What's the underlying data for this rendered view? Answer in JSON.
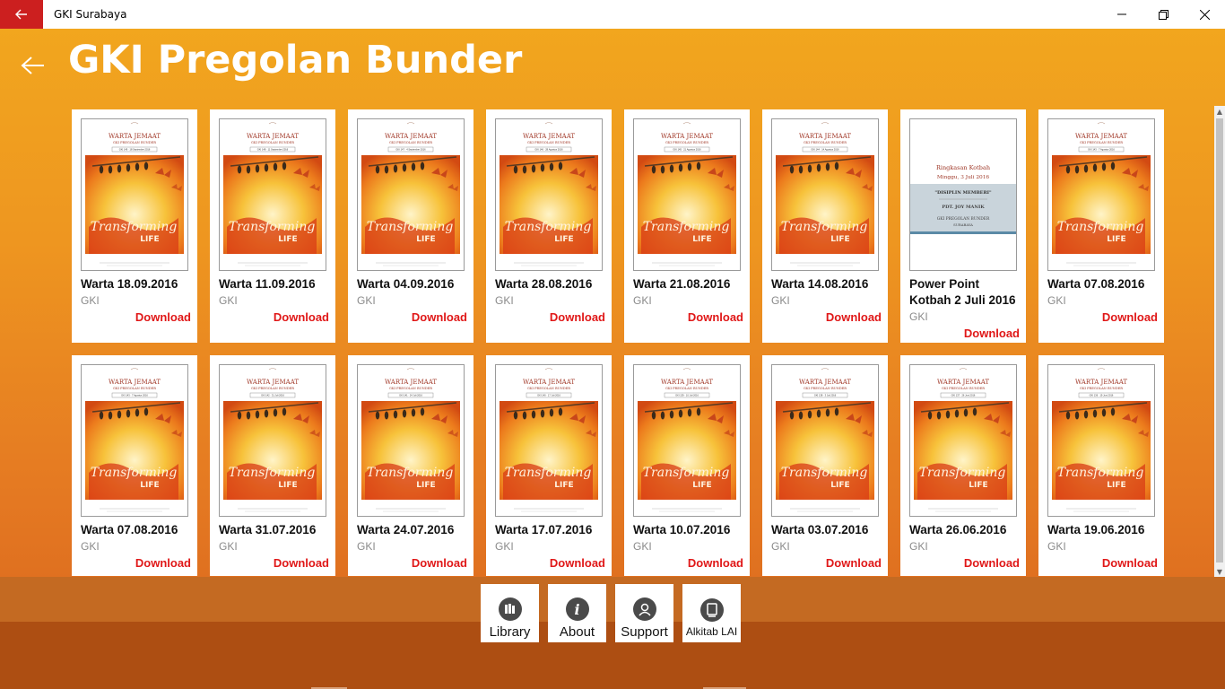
{
  "window": {
    "title": "GKI Surabaya"
  },
  "page": {
    "title": "GKI Pregolan Bunder"
  },
  "colors": {
    "accent_red": "#cc1f1f",
    "download_red": "#e01818",
    "bg_top": "#f2a81e",
    "bg_bottom": "#d9651e",
    "appbar": "#b55517"
  },
  "items": [
    {
      "title": "Warta 18.09.2016",
      "sub": "GKI",
      "action": "Download",
      "thumb": "warta",
      "edition": "GKI 149 · 18 September 2016"
    },
    {
      "title": "Warta 11.09.2016",
      "sub": "GKI",
      "action": "Download",
      "thumb": "warta",
      "edition": "GKI 148 · 11 September 2016"
    },
    {
      "title": "Warta 04.09.2016",
      "sub": "GKI",
      "action": "Download",
      "thumb": "warta",
      "edition": "GKI 147 · 4 September 2016"
    },
    {
      "title": "Warta 28.08.2016",
      "sub": "GKI",
      "action": "Download",
      "thumb": "warta",
      "edition": "GKI 146 · 28 Agustus 2016"
    },
    {
      "title": "Warta 21.08.2016",
      "sub": "GKI",
      "action": "Download",
      "thumb": "warta",
      "edition": "GKI 145 · 21 Agustus 2016"
    },
    {
      "title": "Warta 14.08.2016",
      "sub": "GKI",
      "action": "Download",
      "thumb": "warta",
      "edition": "GKI 144 · 14 Agustus 2016"
    },
    {
      "title": "Power Point Kotbah 2 Juli 2016",
      "sub": "GKI",
      "action": "Download",
      "thumb": "kotbah",
      "kotbah": {
        "l1": "Ringkasan Kotbah",
        "l2": "Minggu, 3 Juli 2016",
        "l3": "\"DISIPLIN MEMBERI\"",
        "l4": "PDT. JOY MANIK",
        "l5": "GKI PREGOLAN BUNDER",
        "l6": "SURABAYA"
      }
    },
    {
      "title": "Warta 07.08.2016",
      "sub": "GKI",
      "action": "Download",
      "thumb": "warta",
      "edition": "GKI 143 · 7 Agustus 2016"
    },
    {
      "title": "Warta 07.08.2016",
      "sub": "GKI",
      "action": "Download",
      "thumb": "warta",
      "edition": "GKI 143 · 7 Agustus 2016"
    },
    {
      "title": "Warta 31.07.2016",
      "sub": "GKI",
      "action": "Download",
      "thumb": "warta",
      "edition": "GKI 142 · 31 Juli 2016"
    },
    {
      "title": "Warta 24.07.2016",
      "sub": "GKI",
      "action": "Download",
      "thumb": "warta",
      "edition": "GKI 141 · 24 Juli 2016"
    },
    {
      "title": "Warta 17.07.2016",
      "sub": "GKI",
      "action": "Download",
      "thumb": "warta",
      "edition": "GKI 140 · 17 Juli 2016"
    },
    {
      "title": "Warta 10.07.2016",
      "sub": "GKI",
      "action": "Download",
      "thumb": "warta",
      "edition": "GKI 139 · 10 Juli 2016"
    },
    {
      "title": "Warta 03.07.2016",
      "sub": "GKI",
      "action": "Download",
      "thumb": "warta",
      "edition": "GKI 138 · 3 Juli 2016"
    },
    {
      "title": "Warta 26.06.2016",
      "sub": "GKI",
      "action": "Download",
      "thumb": "warta",
      "edition": "GKI 137 · 26 Juni 2016"
    },
    {
      "title": "Warta 19.06.2016",
      "sub": "GKI",
      "action": "Download",
      "thumb": "warta",
      "edition": "GKI 136 · 19 Juni 2016"
    }
  ],
  "warta_cover": {
    "header": "WARTA JEMAAT",
    "subheader": "GKI PREGOLAN BUNDER",
    "art": "Transforming",
    "art2": "LIFE"
  },
  "appbar": {
    "buttons": [
      {
        "label": "Library",
        "icon": "library-icon"
      },
      {
        "label": "About",
        "icon": "info-icon"
      },
      {
        "label": "Support",
        "icon": "support-icon"
      },
      {
        "label": "Alkitab LAI",
        "icon": "bible-icon"
      }
    ]
  }
}
